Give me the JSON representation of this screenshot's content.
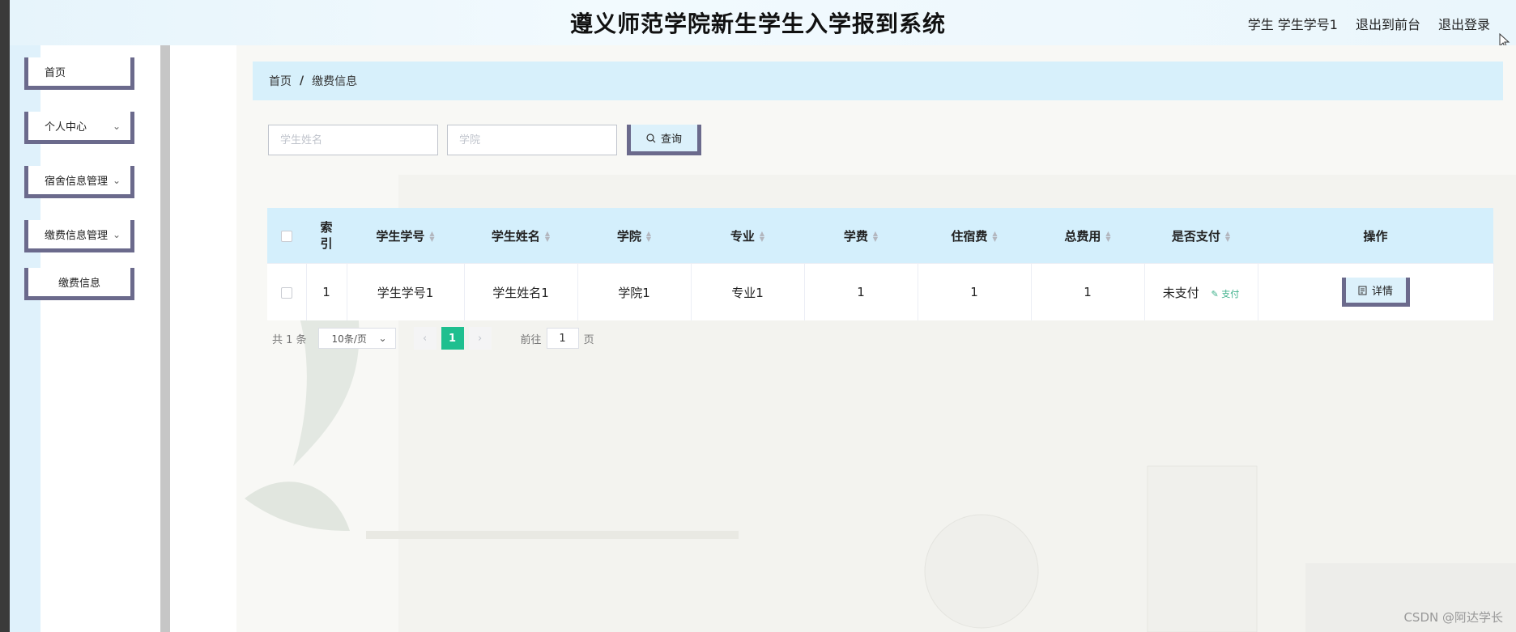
{
  "header": {
    "title": "遵义师范学院新生学生入学报到系统",
    "user": "学生 学生学号1",
    "to_front": "退出到前台",
    "logout": "退出登录"
  },
  "sidebar": {
    "items": [
      {
        "label": "首页",
        "has_arrow": false
      },
      {
        "label": "个人中心",
        "has_arrow": true
      },
      {
        "label": "宿舍信息管理",
        "has_arrow": true
      },
      {
        "label": "缴费信息管理",
        "has_arrow": true
      },
      {
        "label": "缴费信息",
        "has_arrow": false
      }
    ]
  },
  "breadcrumb": {
    "home": "首页",
    "separator": "/",
    "current": "缴费信息"
  },
  "search": {
    "name_placeholder": "学生姓名",
    "college_placeholder": "学院",
    "query_label": "查询"
  },
  "table": {
    "columns": [
      "索引",
      "学生学号",
      "学生姓名",
      "学院",
      "专业",
      "学费",
      "住宿费",
      "总费用",
      "是否支付",
      "操作"
    ],
    "rows": [
      {
        "index": "1",
        "student_no": "学生学号1",
        "student_name": "学生姓名1",
        "college": "学院1",
        "major": "专业1",
        "tuition": "1",
        "lodging": "1",
        "total": "1",
        "paid": "未支付",
        "pay_action": "支付",
        "detail_action": "详情"
      }
    ]
  },
  "pagination": {
    "total": "共 1 条",
    "page_size": "10条/页",
    "current_page": "1",
    "goto_label": "前往",
    "goto_value": "1",
    "page_suffix": "页"
  },
  "watermark": "CSDN @阿达学长",
  "colors": {
    "accent": "#1fbf8f",
    "header_bg": "#d4effc",
    "button_border": "#6b6a8c"
  }
}
